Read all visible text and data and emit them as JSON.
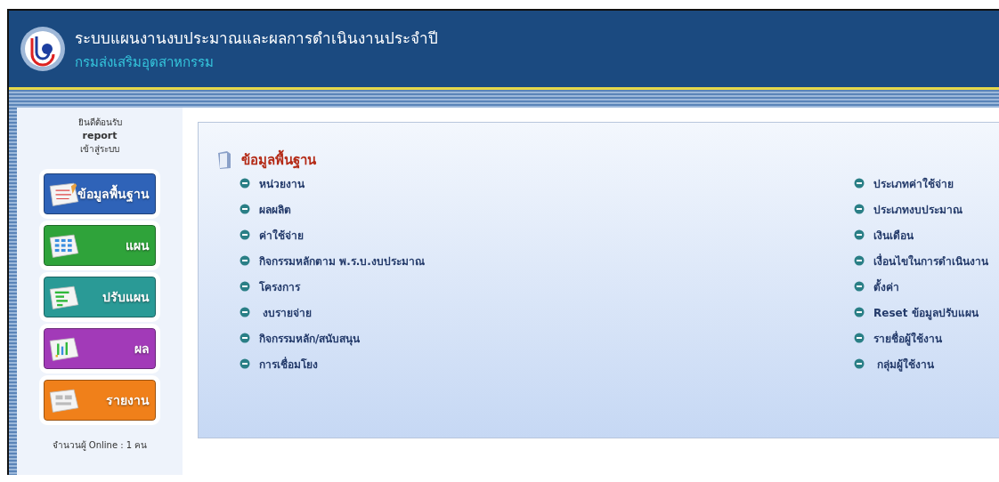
{
  "header": {
    "title": "ระบบแผนงานงบประมาณและผลการดำเนินงานประจำปี",
    "subtitle": "กรมส่งเสริมอุตสาหกรรม"
  },
  "sidebar": {
    "welcome": "ยินดีต้อนรับ",
    "user": "report",
    "login_note": "เข้าสู่ระบบ",
    "menu": [
      {
        "label": "ข้อมูลพื้นฐาน",
        "kind": "document",
        "color": "#2f63b8"
      },
      {
        "label": "แผน",
        "kind": "grid",
        "color": "#2fa33a"
      },
      {
        "label": "ปรับแผน",
        "kind": "bars",
        "color": "#2a9a96"
      },
      {
        "label": "ผล",
        "kind": "chart",
        "color": "#a23ab8"
      },
      {
        "label": "รายงาน",
        "kind": "report",
        "color": "#f0801a"
      }
    ],
    "online": "จำนวนผู้ Online : 1 คน"
  },
  "panel": {
    "title": "ข้อมูลพื้นฐาน",
    "columns": [
      [
        "หน่วยงาน",
        "ผลผลิต",
        "ค่าใช้จ่าย",
        "กิจกรรมหลักตาม พ.ร.บ.งบประมาณ",
        "โครงการ",
        " งบรายจ่าย",
        "กิจกรรมหลัก/สนับสนุน",
        "การเชื่อมโยง"
      ],
      [
        "ประเภทค่าใช้จ่าย",
        "ประเภทงบประมาณ",
        "เงินเดือน",
        "เงื่อนไขในการดำเนินงาน",
        "ตั้งค่า",
        "Reset ข้อมูลปรับแผน",
        "รายชื่อผู้ใช้งาน",
        " กลุ่มผู้ใช้งาน"
      ]
    ]
  }
}
